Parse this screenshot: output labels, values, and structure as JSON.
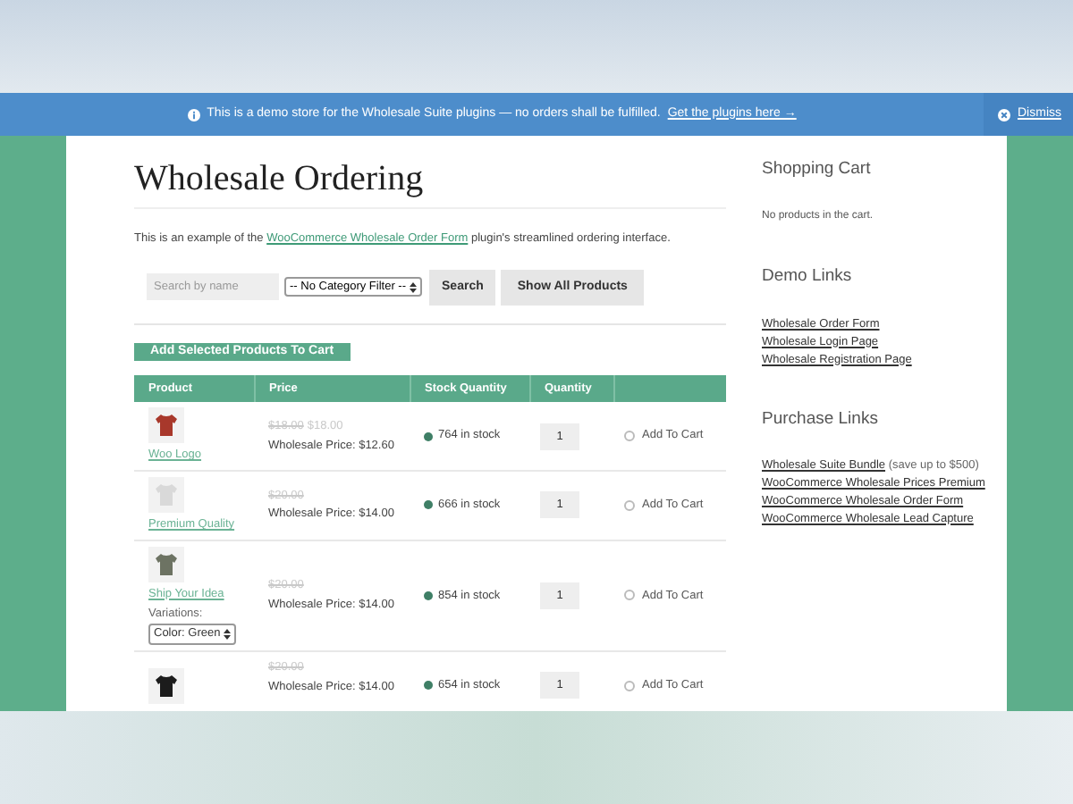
{
  "banner": {
    "text": "This is a demo store for the Wholesale Suite plugins — no orders shall be fulfilled.",
    "link": "Get the plugins here →",
    "dismiss": "Dismiss"
  },
  "title": "Wholesale Ordering",
  "intro": {
    "before": "This is an example of the ",
    "link": "WooCommerce Wholesale Order Form",
    "after": " plugin's streamlined ordering interface."
  },
  "search": {
    "placeholder": "Search by name"
  },
  "category_select": "-- No Category Filter --",
  "search_button": "Search",
  "show_all_button": "Show All Products",
  "add_selected_button": "Add Selected Products To Cart",
  "table": {
    "columns": [
      "Product",
      "Price",
      "Stock Quantity",
      "Quantity"
    ],
    "rows": [
      {
        "name": "Woo Logo",
        "color": "#a8382b",
        "regular_price": "$18.00",
        "sale_price": "$18.00",
        "wholesale_price": "Wholesale Price: $12.60",
        "stock": "764 in stock",
        "quantity": "1",
        "add_label": "Add To Cart",
        "checked": false
      },
      {
        "name": "Premium Quality",
        "color": "#d9d9d9",
        "regular_price": "$20.00",
        "wholesale_price": "Wholesale Price: $14.00",
        "stock": "666 in stock",
        "quantity": "1",
        "add_label": "Add To Cart",
        "checked": false
      },
      {
        "name": "Ship Your Idea",
        "color": "#6d7363",
        "regular_price": "$20.00",
        "wholesale_price": "Wholesale Price: $14.00",
        "stock": "854 in stock",
        "quantity": "1",
        "add_label": "Add To Cart",
        "checked": false,
        "variations_label": "Variations:",
        "variation": "Color: Green"
      },
      {
        "color": "#1c1c1c",
        "regular_price": "$20.00",
        "wholesale_price": "Wholesale Price: $14.00",
        "stock": "654 in stock",
        "quantity": "1",
        "add_label": "Add To Cart",
        "checked": false
      }
    ]
  },
  "sidebar": [
    {
      "heading": "Shopping Cart",
      "text": "No products in the cart."
    },
    {
      "heading": "Demo Links",
      "links": [
        {
          "link": "Wholesale Order Form"
        },
        {
          "link": "Wholesale Login Page"
        },
        {
          "link": "Wholesale Registration Page"
        }
      ]
    },
    {
      "heading": "Purchase Links",
      "links": [
        {
          "link": "Wholesale Suite Bundle",
          "note": " (save up to $500)"
        },
        {
          "link": "WooCommerce Wholesale Prices Premium"
        },
        {
          "link": "WooCommerce Wholesale Order Form"
        },
        {
          "link": "WooCommerce Wholesale Lead Capture"
        }
      ]
    }
  ]
}
